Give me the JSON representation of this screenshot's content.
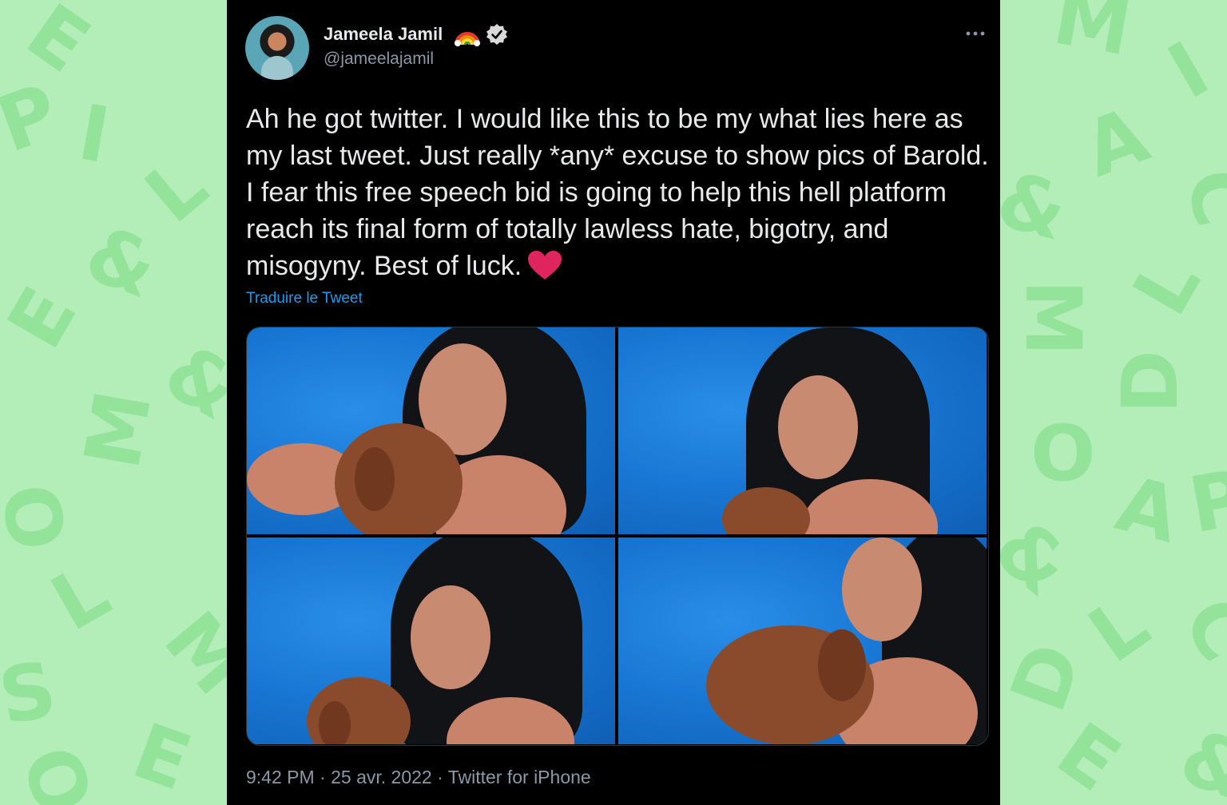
{
  "background": {
    "color": "#b3eeb8",
    "letter_color": "#93e39b"
  },
  "tweet": {
    "author": {
      "display_name": "Jameela Jamil",
      "handle": "@jameelajamil",
      "badges": [
        "rainbow-icon",
        "verified-icon"
      ]
    },
    "text": "Ah he got twitter. I would like this to be my what lies here as my last tweet. Just really *any* excuse to show pics of Barold. I fear this free speech bid is going to help this hell platform reach its final form of totally lawless hate, bigotry, and misogyny. Best of luck.",
    "text_emoji": "heart-icon",
    "translate_label": "Traduire le Tweet",
    "media_count": 4,
    "meta": "9:42 PM · 25 avr. 2022 · Twitter for iPhone"
  },
  "colors": {
    "card_bg": "#000000",
    "text_primary": "#e7e9ea",
    "text_secondary": "#8b98a5",
    "link": "#1d9bf0",
    "heart": "#e0245e"
  }
}
